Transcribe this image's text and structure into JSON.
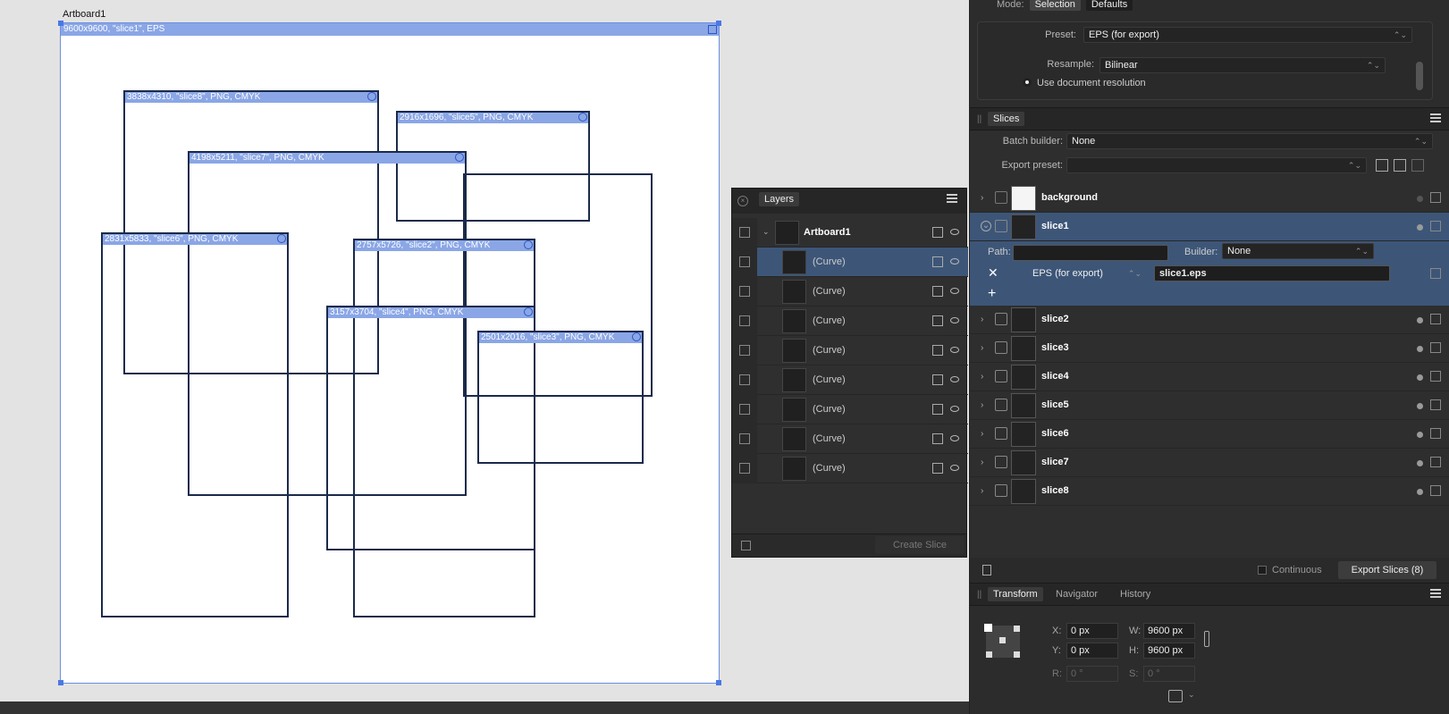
{
  "artboard": {
    "title": "Artboard1",
    "label": "9600x9600, \"slice1\", EPS"
  },
  "canvas_slices": [
    {
      "label": "3838x4310, \"slice8\", PNG, CMYK"
    },
    {
      "label": "2916x1696, \"slice5\", PNG, CMYK"
    },
    {
      "label": "4198x5211, \"slice7\", PNG, CMYK"
    },
    {
      "label": "2831x5833, \"slice6\", PNG, CMYK"
    },
    {
      "label": "2757x5726, \"slice2\", PNG, CMYK"
    },
    {
      "label": "3157x3704, \"slice4\", PNG, CMYK"
    },
    {
      "label": "2501x2016, \"slice3\", PNG, CMYK"
    }
  ],
  "export_panel": {
    "mode_label": "Mode:",
    "mode_selection": "Selection",
    "mode_defaults": "Defaults",
    "preset_label": "Preset:",
    "preset_value": "EPS (for export)",
    "resample_label": "Resample:",
    "resample_value": "Bilinear",
    "use_doc_res": "Use document resolution"
  },
  "slices_panel": {
    "tab": "Slices",
    "batch_builder_label": "Batch builder:",
    "batch_builder_value": "None",
    "export_preset_label": "Export preset:",
    "rows": [
      {
        "label": "background"
      },
      {
        "label": "slice1"
      },
      {
        "label": "slice2"
      },
      {
        "label": "slice3"
      },
      {
        "label": "slice4"
      },
      {
        "label": "slice5"
      },
      {
        "label": "slice6"
      },
      {
        "label": "slice7"
      },
      {
        "label": "slice8"
      }
    ],
    "path_label": "Path:",
    "builder_label": "Builder:",
    "builder_value": "None",
    "format_value": "EPS (for export)",
    "filename_value": "slice1.eps",
    "continuous_label": "Continuous",
    "export_button": "Export Slices (8)"
  },
  "layers_panel": {
    "title": "Layers",
    "rows": [
      {
        "name": "Artboard1"
      },
      {
        "name": "(Curve)"
      },
      {
        "name": "(Curve)"
      },
      {
        "name": "(Curve)"
      },
      {
        "name": "(Curve)"
      },
      {
        "name": "(Curve)"
      },
      {
        "name": "(Curve)"
      },
      {
        "name": "(Curve)"
      },
      {
        "name": "(Curve)"
      }
    ],
    "create_slice": "Create Slice"
  },
  "transform_panel": {
    "tabs": [
      "Transform",
      "Navigator",
      "History"
    ],
    "x_label": "X:",
    "x_value": "0 px",
    "y_label": "Y:",
    "y_value": "0 px",
    "w_label": "W:",
    "w_value": "9600 px",
    "h_label": "H:",
    "h_value": "9600 px",
    "r_label": "R:",
    "r_value": "0 °",
    "s_label": "S:",
    "s_value": "0 °"
  },
  "colors": {
    "slice_bar": "#8aa6e6",
    "selection_row": "#3d5678",
    "panel_bg": "#2e2e2e"
  }
}
